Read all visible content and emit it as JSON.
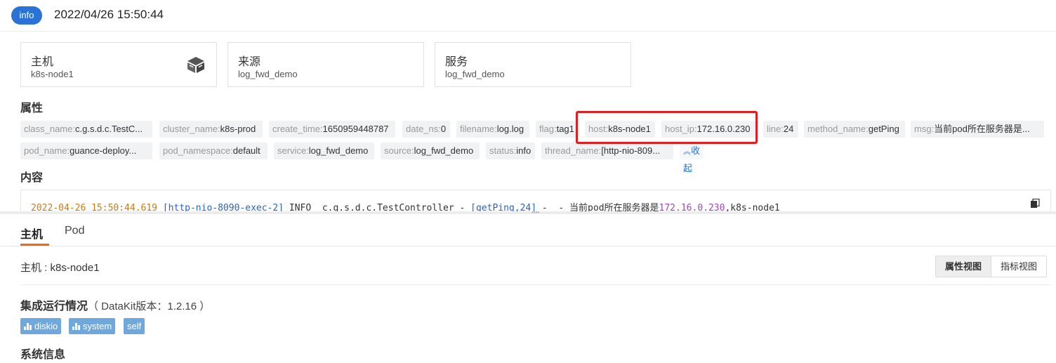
{
  "header": {
    "level": "info",
    "time": "2022/04/26 15:50:44"
  },
  "cards": [
    {
      "title": "主机",
      "value": "k8s-node1",
      "icon": "server-icon"
    },
    {
      "title": "来源",
      "value": "log_fwd_demo"
    },
    {
      "title": "服务",
      "value": "log_fwd_demo"
    }
  ],
  "attributes": {
    "title": "属性",
    "tags": [
      {
        "key": "class_name:",
        "value": "c.g.s.d.c.TestC..."
      },
      {
        "key": "cluster_name:",
        "value": "k8s-prod"
      },
      {
        "key": "create_time:",
        "value": "1650959448787"
      },
      {
        "key": "date_ns:",
        "value": "0"
      },
      {
        "key": "filename:",
        "value": "log.log"
      },
      {
        "key": "flag:",
        "value": "tag1"
      },
      {
        "key": "host:",
        "value": "k8s-node1"
      },
      {
        "key": "host_ip:",
        "value": "172.16.0.230"
      },
      {
        "key": "line:",
        "value": "24"
      },
      {
        "key": "method_name:",
        "value": "getPing"
      },
      {
        "key": "msg:",
        "value": "当前pod所在服务器是..."
      },
      {
        "key": "pod_name:",
        "value": "guance-deploy..."
      },
      {
        "key": "pod_namespace:",
        "value": "default"
      },
      {
        "key": "service:",
        "value": "log_fwd_demo"
      },
      {
        "key": "source:",
        "value": "log_fwd_demo"
      },
      {
        "key": "status:",
        "value": "info"
      },
      {
        "key": "thread_name:",
        "value": "[http-nio-809..."
      }
    ],
    "collapse_label": "收起"
  },
  "content": {
    "title": "内容",
    "log": {
      "time": "2022-04-26 15:50:44.619",
      "thread": "[http-nio-8090-exec-2]",
      "level": "INFO",
      "class": "c.g.s.d.c.TestController",
      "method": "[getPing,24]",
      "msg_prefix": "当前pod所在服务器是",
      "ip": "172.16.0.230",
      "msg_suffix": ",k8s-node1"
    }
  },
  "tabs": [
    {
      "label": "主机",
      "active": true
    },
    {
      "label": "Pod",
      "active": false
    }
  ],
  "host_panel": {
    "host_line": "主机 : k8s-node1",
    "view_buttons": [
      "属性视图",
      "指标视图"
    ],
    "integration_title": "集成运行情况",
    "integration_version": "（ DataKit版本：1.2.16 ）",
    "plugins": [
      {
        "label": "diskio",
        "icon": "bar-chart-icon"
      },
      {
        "label": "system",
        "icon": "bar-chart-icon"
      },
      {
        "label": "self"
      }
    ],
    "system_title": "系统信息"
  },
  "colors": {
    "accent": "#2a73d6",
    "highlight": "#e02020",
    "tab_underline": "#f06a0e",
    "plugin_bg": "#6fa8dc"
  }
}
